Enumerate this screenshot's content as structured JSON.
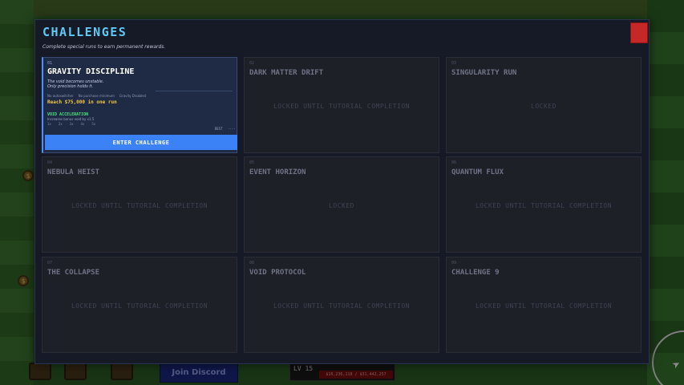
{
  "hud": {
    "discord_label": "Join Discord",
    "level_label": "LV 15",
    "xp_text": "$10,236,118 / $31,442,257"
  },
  "modal": {
    "title": "CHALLENGES",
    "subtitle": "Complete special runs to earn permanent rewards."
  },
  "challenges": [
    {
      "num": "01",
      "name": "GRAVITY DISCIPLINE",
      "desc_line1": "The void becomes unstable.",
      "desc_line2": "Only precision holds it.",
      "tags": [
        "No autoswitcher",
        "No purchase minimum",
        "Gravity Disabled"
      ],
      "goal": "Reach $75,000 in one run",
      "reward_title": "VOID ACCELERATION",
      "reward_desc": "Increases bonus void by x1.5",
      "tiers": [
        "1x",
        "2x",
        "3x",
        "4x",
        "5x"
      ],
      "best_label": "BEST",
      "best_value": "----",
      "button_label": "ENTER CHALLENGE"
    },
    {
      "num": "02",
      "name": "DARK MATTER DRIFT",
      "status": "LOCKED UNTIL TUTORIAL COMPLETION"
    },
    {
      "num": "03",
      "name": "SINGULARITY RUN",
      "status": "LOCKED"
    },
    {
      "num": "04",
      "name": "NEBULA HEIST",
      "status": "LOCKED UNTIL TUTORIAL COMPLETION"
    },
    {
      "num": "05",
      "name": "EVENT HORIZON",
      "status": "LOCKED"
    },
    {
      "num": "06",
      "name": "QUANTUM FLUX",
      "status": "LOCKED UNTIL TUTORIAL COMPLETION"
    },
    {
      "num": "07",
      "name": "THE COLLAPSE",
      "status": "LOCKED UNTIL TUTORIAL COMPLETION"
    },
    {
      "num": "08",
      "name": "VOID PROTOCOL",
      "status": "LOCKED UNTIL TUTORIAL COMPLETION"
    },
    {
      "num": "09",
      "name": "CHALLENGE 9",
      "status": "LOCKED UNTIL TUTORIAL COMPLETION"
    }
  ],
  "colors": {
    "accent_title": "#5ec9f5",
    "button_blue": "#3b82f6",
    "goal_gold": "#f2c744",
    "reward_green": "#4be07a",
    "close_red": "#c62828"
  }
}
